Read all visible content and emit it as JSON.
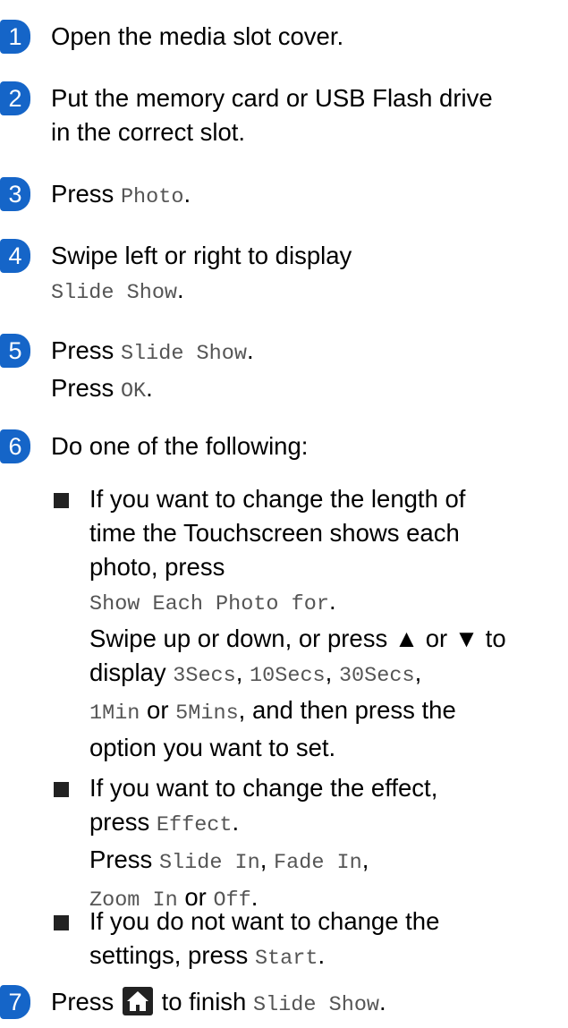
{
  "steps": [
    {
      "num": "1",
      "text": "Open the media slot cover."
    },
    {
      "num": "2",
      "line1": "Put the memory card or USB Flash drive",
      "line2": "in the correct slot."
    },
    {
      "num": "3",
      "pre": "Press ",
      "code": "Photo",
      "post": "."
    },
    {
      "num": "4",
      "line1": "Swipe left or right to display",
      "code": "Slide Show",
      "post": "."
    },
    {
      "num": "5",
      "pre": "Press ",
      "code": "Slide Show",
      "post": ".",
      "pre2": "Press ",
      "code2": "OK",
      "post2": "."
    },
    {
      "num": "6",
      "text": "Do one of the following:"
    },
    {
      "num": "7",
      "pre": "Press ",
      "icon": "home-icon",
      "mid": " to finish ",
      "code": "Slide Show",
      "post": "."
    }
  ],
  "bullets": [
    {
      "l1": "If you want to change the length of",
      "l2": "time the Touchscreen shows each",
      "l3": "photo, press",
      "code1": "Show Each Photo for",
      "p1": ".",
      "l5": "Swipe up or down, or press ▲ or ▼ to",
      "l6pre": "display ",
      "o1": "3Secs",
      "s1": ", ",
      "o2": "10Secs",
      "s2": ", ",
      "o3": "30Secs",
      "s3": ",",
      "o4": "1Min",
      "or": " or ",
      "o5": "5Mins",
      "l7post": ", and then press the",
      "l8": "option you want to set."
    },
    {
      "l1": "If you want to change the effect,",
      "l2pre": "press ",
      "code": "Effect",
      "l2post": ".",
      "l3pre": "Press ",
      "e1": "Slide In",
      "c1": ", ",
      "e2": "Fade In",
      "c2": ",",
      "e3": "Zoom In",
      "or": " or ",
      "e4": "Off",
      "end": "."
    },
    {
      "l1": "If you do not want to change the",
      "l2pre": "settings, press ",
      "code": "Start",
      "l2post": "."
    }
  ]
}
